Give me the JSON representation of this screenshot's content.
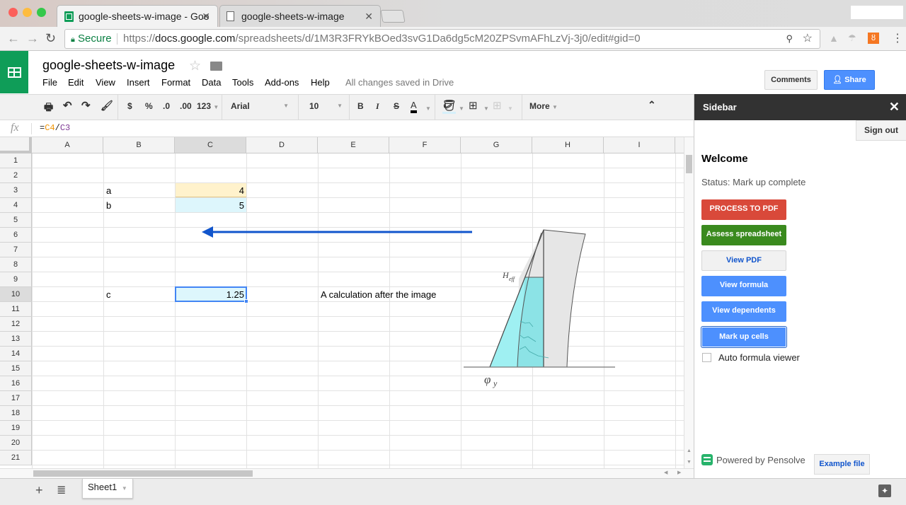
{
  "browser": {
    "tabs": [
      {
        "title": "google-sheets-w-image - Goo",
        "active": true,
        "icon": "sheets-icon"
      },
      {
        "title": "google-sheets-w-image",
        "active": false,
        "icon": "page-icon"
      }
    ],
    "secure_label": "Secure",
    "url_prefix": "https://",
    "url_domain": "docs.google.com",
    "url_path": "/spreadsheets/d/1M3R3FRYkBOed3svG1Da6dg5cM20ZPSvmAFhLzVj-3j0/edit#gid=0"
  },
  "app": {
    "doc_title": "google-sheets-w-image",
    "menu": [
      "File",
      "Edit",
      "View",
      "Insert",
      "Format",
      "Data",
      "Tools",
      "Add-ons",
      "Help"
    ],
    "save_status": "All changes saved in Drive",
    "comments_label": "Comments",
    "share_label": "Share"
  },
  "toolbar": {
    "currency": "$",
    "percent": "%",
    "dec_less": ".0",
    "dec_more": ".00",
    "number_format": "123",
    "font": "Arial",
    "font_size": "10",
    "bold": "B",
    "italic": "I",
    "strike": "S",
    "text_color": "A",
    "more": "More"
  },
  "formula_bar": {
    "fx": "fx",
    "eq": "=",
    "ref1": "C4",
    "slash": "/",
    "ref2": "C3",
    "ref1_color": "#f09300",
    "ref2_color": "#7e3794"
  },
  "grid": {
    "columns": [
      "A",
      "B",
      "C",
      "D",
      "E",
      "F",
      "G",
      "H",
      "I"
    ],
    "selected_column": "C",
    "rows": [
      "1",
      "2",
      "3",
      "4",
      "5",
      "6",
      "7",
      "8",
      "9",
      "10",
      "11",
      "12",
      "13",
      "14",
      "15",
      "16",
      "17",
      "18",
      "19",
      "20",
      "21"
    ],
    "selected_row": "10",
    "cells": {
      "B3": "a",
      "C3": "4",
      "B4": "b",
      "C4": "5",
      "B10": "c",
      "C10": "1.25",
      "E10": "A calculation after the image"
    },
    "highlight_colors": {
      "C3": "#fff2cc",
      "C4": "#ddf6fc",
      "C10": "#ddf6fc"
    },
    "image_labels": {
      "h_eff": "H",
      "h_eff_sub": "eff",
      "phi": "φ",
      "phi_sub": "y"
    }
  },
  "sheets": {
    "tabs": [
      "Sheet1"
    ]
  },
  "sidebar": {
    "title": "Sidebar",
    "sign_out": "Sign out",
    "welcome": "Welcome",
    "status": "Status: Mark up complete",
    "buttons": [
      {
        "label": "PROCESS TO PDF",
        "bg": "#d9493a",
        "fg": "#ffffff"
      },
      {
        "label": "Assess spreadsheet",
        "bg": "#3a8a1e",
        "fg": "#ffffff"
      },
      {
        "label": "View PDF",
        "bg": "#f1f1f1",
        "fg": "#1155cc"
      },
      {
        "label": "View formula",
        "bg": "#4d90fe",
        "fg": "#ffffff"
      },
      {
        "label": "View dependents",
        "bg": "#4d90fe",
        "fg": "#ffffff"
      },
      {
        "label": "Mark up cells",
        "bg": "#4d90fe",
        "fg": "#ffffff"
      }
    ],
    "auto_formula_label": "Auto formula viewer",
    "auto_formula_checked": false,
    "powered_by": "Powered by Pensolve",
    "example_file": "Example file"
  }
}
